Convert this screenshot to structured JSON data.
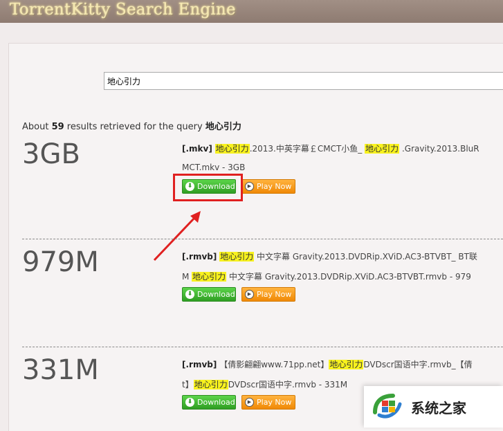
{
  "header": {
    "brand": "TorrentKitty Search Engine"
  },
  "search": {
    "value": "地心引力"
  },
  "summary": {
    "prefix": "About ",
    "count": "59",
    "middle": " results retrieved for the query ",
    "query": "地心引力"
  },
  "buttons": {
    "download": "Download",
    "play": "Play Now"
  },
  "results": [
    {
      "size": "3GB",
      "line1": {
        "ext": "[.mkv]",
        "hl1": "地心引力",
        "t1": ".2013.中英字幕￡CMCT小鱼_",
        "hl2": "地心引力",
        "t2": ".Gravity.2013.BluR"
      },
      "line2": {
        "t1": "MCT.mkv - 3GB"
      }
    },
    {
      "size": "979M",
      "line1": {
        "ext": "[.rmvb]",
        "hl1": "地心引力",
        "t1": " 中文字幕 Gravity.2013.DVDRip.XViD.AC3-BTVBT_ BT联"
      },
      "line2": {
        "t1": "M ",
        "hl1": "地心引力",
        "t2": " 中文字幕 Gravity.2013.DVDRip.XViD.AC3-BTVBT.rmvb - 979"
      }
    },
    {
      "size": "331M",
      "line1": {
        "ext": "[.rmvb]",
        "t1": " 【倩影翩翩www.71pp.net】",
        "hl1": "地心引力",
        "t2": "DVDscr国语中字.rmvb_【倩"
      },
      "line2": {
        "t1": "t】",
        "hl1": "地心引力",
        "t2": "DVDscr国语中字.rmvb - 331M"
      }
    }
  ],
  "watermark": {
    "text": "系统之家",
    "icon": "windows-logo-icon"
  },
  "colors": {
    "highlight": "#f8f21e",
    "download": "#3cb02e",
    "play": "#f59a14",
    "annotation": "#e02020"
  }
}
